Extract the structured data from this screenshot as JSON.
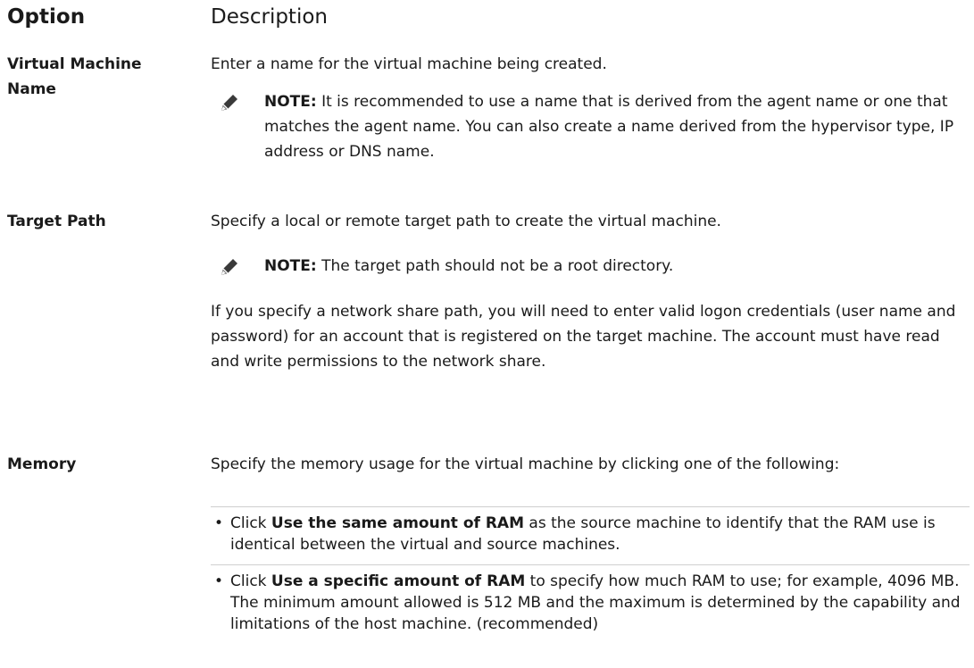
{
  "header": {
    "option": "Option",
    "description": "Description"
  },
  "rows": {
    "vm_name": {
      "term": "Virtual Machine Name",
      "desc": "Enter a name for the virtual machine being created.",
      "note_label": "NOTE:",
      "note_text": " It is recommended to use a name that is derived from the agent name or one that matches the agent name. You can also create a name derived from the hypervisor type, IP address or DNS name."
    },
    "target_path": {
      "term": "Target Path",
      "desc": "Specify a local or remote target path to create the virtual machine.",
      "note_label": "NOTE:",
      "note_text": " The target path should not be a root directory.",
      "extra": "If you specify a network share path, you will need to enter valid logon credentials (user name and password) for an account that is registered on the target machine. The account must have read and write permissions to the network share."
    },
    "memory": {
      "term": "Memory",
      "desc": "Specify the memory usage for the virtual machine by clicking one of the following:",
      "bullets": [
        {
          "lead": "Click ",
          "bold": "Use the same amount of RAM",
          "rest": " as the source machine to identify that the RAM use is identical between the virtual and source machines."
        },
        {
          "lead": "Click ",
          "bold": "Use a specific amount of RAM",
          "rest": " to specify how much RAM to use; for example, 4096 MB. The minimum amount allowed is 512 MB and the maximum is determined by the capability and limitations of the host machine. (recommended)"
        }
      ]
    }
  },
  "icons": {
    "note": "pencil-icon"
  }
}
